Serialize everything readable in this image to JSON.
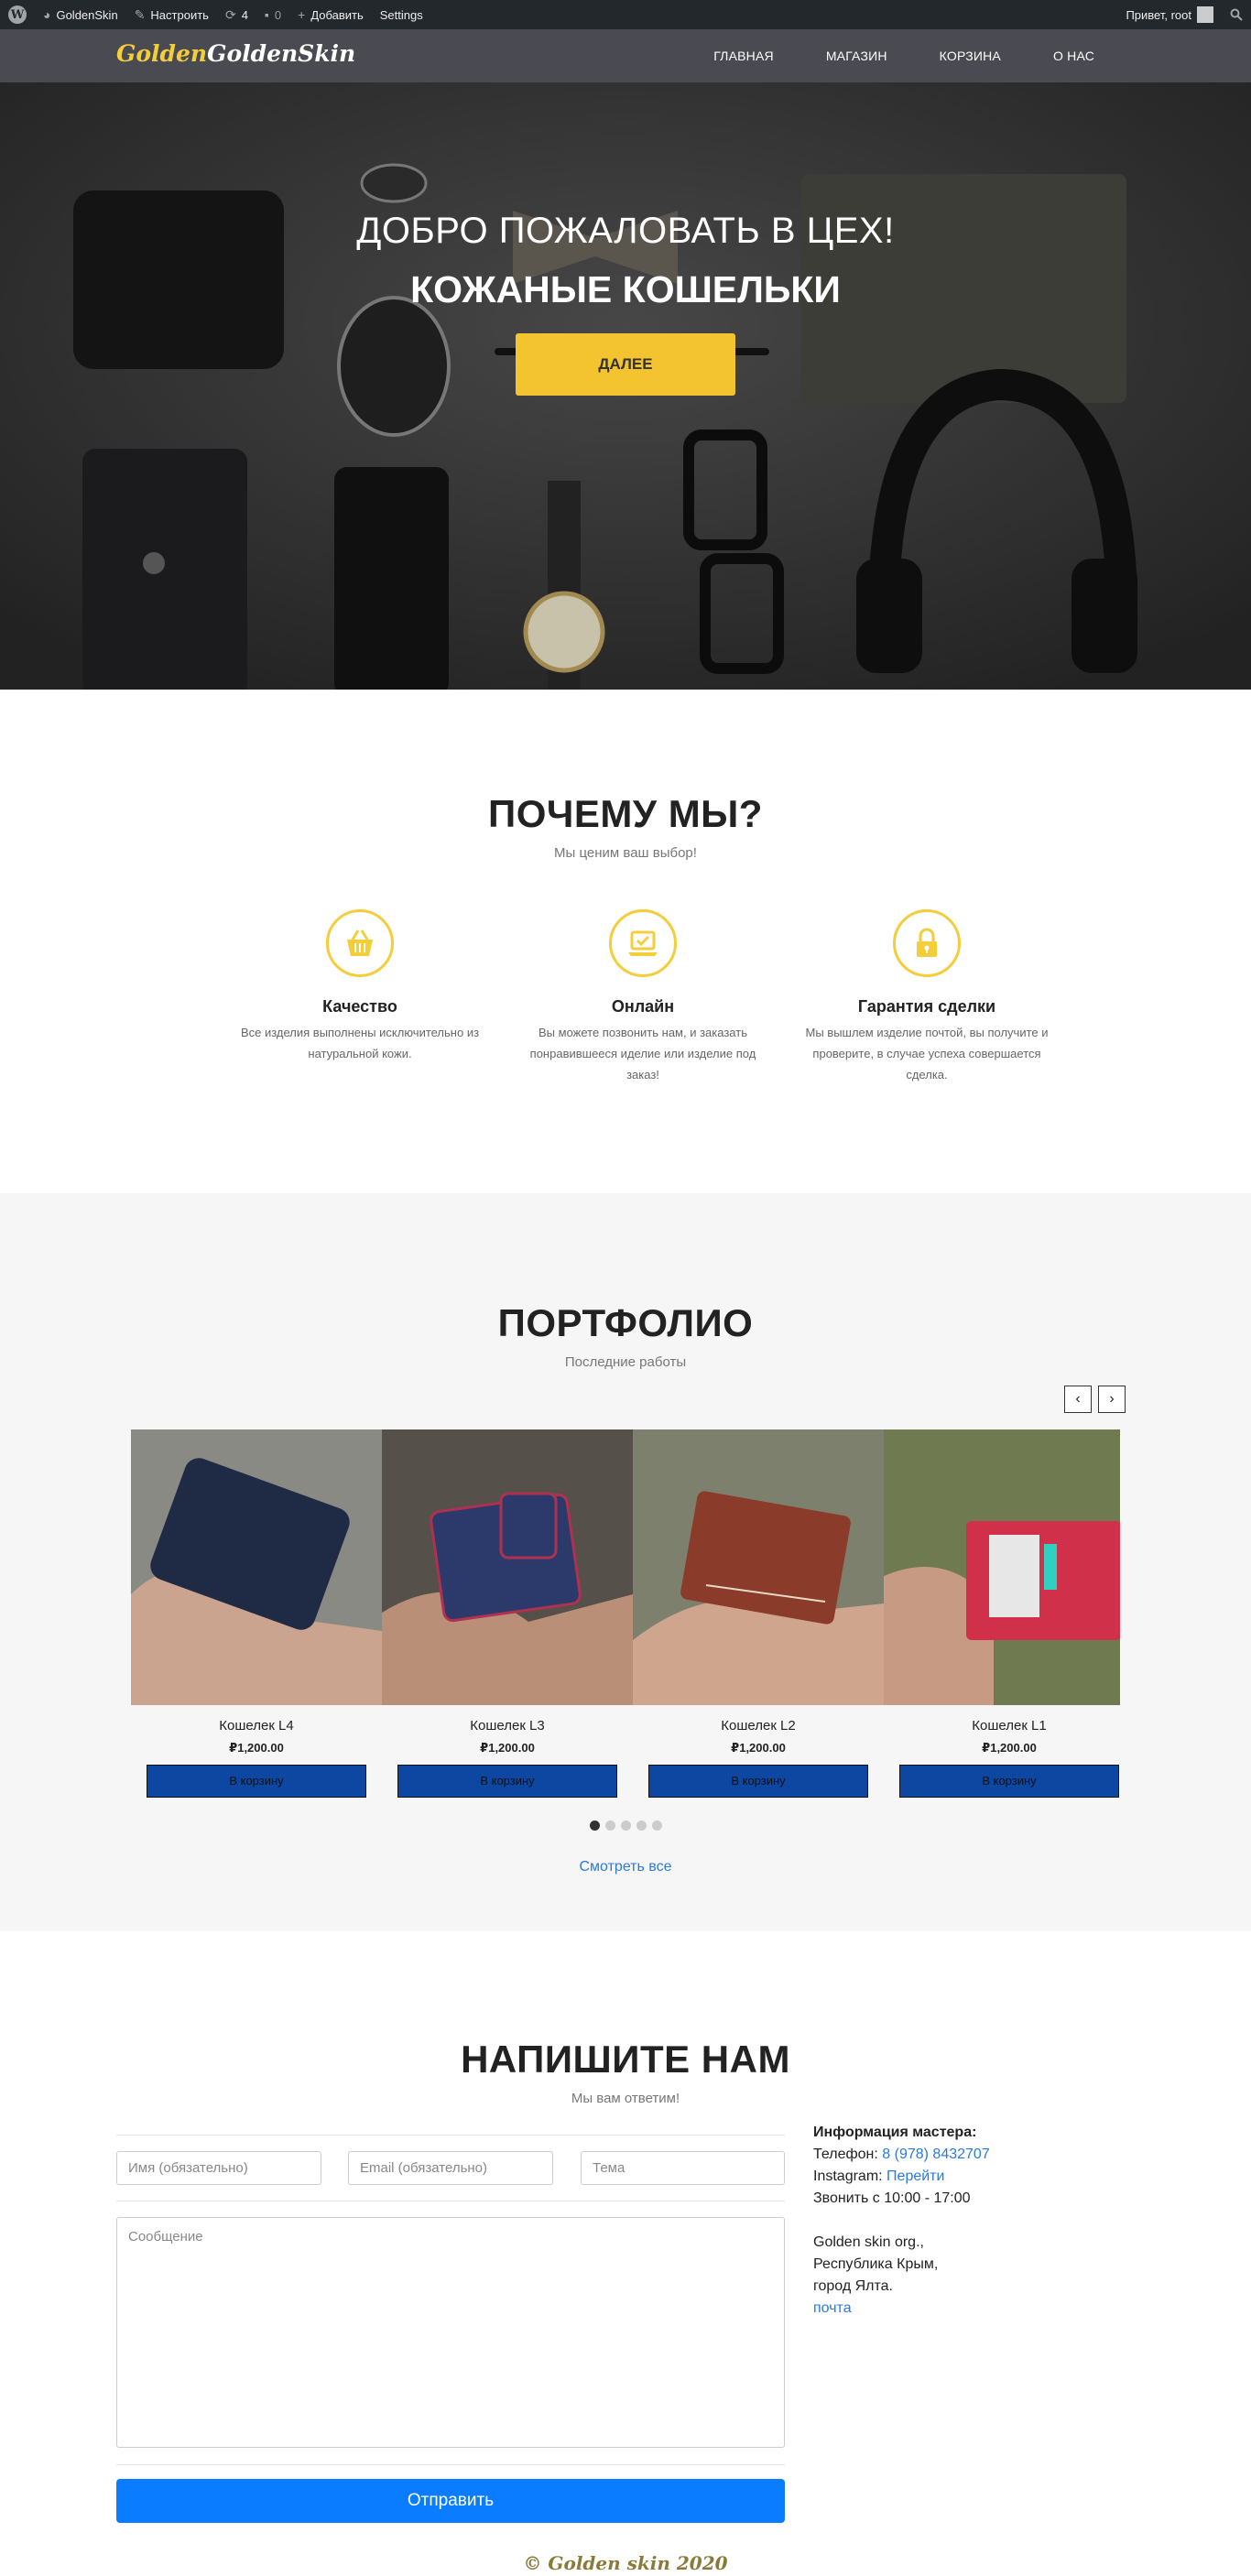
{
  "adminbar": {
    "site_name": "GoldenSkin",
    "customize": "Настроить",
    "updates": "4",
    "comments": "0",
    "add_new": "Добавить",
    "settings": "Settings",
    "greeting": "Привет, root"
  },
  "nav": {
    "logo_part1": "Golden",
    "logo_part2": "GoldenSkin",
    "items": [
      "ГЛАВНАЯ",
      "МАГАЗИН",
      "КОРЗИНА",
      "О НАС"
    ]
  },
  "hero": {
    "subtitle": "ДОБРО ПОЖАЛОВАТЬ В ЦЕХ!",
    "title": "КОЖАНЫЕ КОШЕЛЬКИ",
    "button": "ДАЛЕЕ"
  },
  "why": {
    "title": "ПОЧЕМУ МЫ?",
    "subtitle": "Мы ценим ваш выбор!",
    "features": [
      {
        "icon": "basket-icon",
        "title": "Качество",
        "text": "Все изделия выполнены исключительно из натуральной кожи."
      },
      {
        "icon": "laptop-icon",
        "title": "Онлайн",
        "text": "Вы можете позвонить нам, и заказать понравившееся иделие или изделие под заказ!"
      },
      {
        "icon": "lock-icon",
        "title": "Гарантия сделки",
        "text": "Мы вышлем изделие почтой, вы получите и проверите, в случае успеха совершается сделка."
      }
    ]
  },
  "portfolio": {
    "title": "ПОРТФОЛИО",
    "subtitle": "Последние работы",
    "prev": "‹",
    "next": "›",
    "products": [
      {
        "name": "Кошелек L4",
        "price": "₽1,200.00",
        "button": "В корзину",
        "color": "#1f2a44"
      },
      {
        "name": "Кошелек L3",
        "price": "₽1,200.00",
        "button": "В корзину",
        "color": "#2c3a6b"
      },
      {
        "name": "Кошелек L2",
        "price": "₽1,200.00",
        "button": "В корзину",
        "color": "#8a3b2a"
      },
      {
        "name": "Кошелек L1",
        "price": "₽1,200.00",
        "button": "В корзину",
        "color": "#d0304a"
      }
    ],
    "active_page": 1,
    "total_pages": 5,
    "see_all": "Смотреть все"
  },
  "contact": {
    "title": "НАПИШИТЕ НАМ",
    "subtitle": "Мы вам ответим!",
    "name_placeholder": "Имя (обязательно)",
    "email_placeholder": "Email (обязательно)",
    "subject_placeholder": "Тема",
    "message_placeholder": "Сообщение",
    "submit": "Отправить",
    "info_heading": "Информация мастера:",
    "phone_label": "Телефон:",
    "phone": "8 (978) 8432707",
    "instagram_label": "Instagram:",
    "instagram_link": "Перейти",
    "hours": "Звонить с 10:00 - 17:00",
    "address_1": "Golden skin org.,",
    "address_2": "Республика Крым,",
    "address_3": "город Ялта.",
    "mail_link": "почта"
  },
  "footer": {
    "copyright": "© Golden skin 2020"
  },
  "colors": {
    "accent": "#f4cd3a",
    "button_blue": "#0a7cff",
    "link": "#2a7ae2",
    "nav_bg": "#4a4a52",
    "adminbar_bg": "#23282d"
  }
}
